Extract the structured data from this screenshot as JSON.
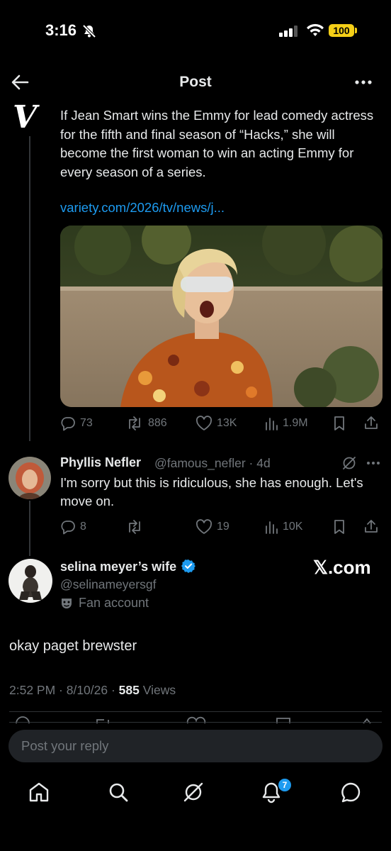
{
  "status_bar": {
    "time": "3:16",
    "battery": "100"
  },
  "header": {
    "title": "Post"
  },
  "quoted_post": {
    "logo": "V",
    "text": "If Jean Smart wins the Emmy for lead comedy actress for the fifth and final season of “Hacks,” she will become the first woman to win an acting Emmy for every season of a series.",
    "link": "variety.com/2026/tv/news/j...",
    "replies": "73",
    "reposts": "886",
    "likes": "13K",
    "views": "1.9M"
  },
  "reply": {
    "name": "Phyllis Nefler",
    "meta": "@famous_nefler · 4d",
    "text": "I'm sorry but this is ridiculous, she has enough. Let's move on.",
    "replies": "8",
    "reposts": "",
    "likes": "19",
    "views": "10K"
  },
  "main_post": {
    "name": "selina meyer’s wife",
    "handle": "@selinameyersgf",
    "fan_label": "Fan account",
    "xcom_badge": "𝕏.com",
    "text": "okay paget brewster",
    "timestamp": "2:52 PM · 8/10/26 · ",
    "views_count": "585",
    "views_label": " Views"
  },
  "reply_box": {
    "placeholder": "Post your reply"
  },
  "bottom_nav": {
    "notifications_badge": "7"
  },
  "colors": {
    "accent": "#1d9bf0",
    "muted": "#71767b",
    "background": "#000000",
    "battery": "#f5cf17"
  },
  "icons": [
    "back-arrow-icon",
    "more-icon",
    "reply-icon",
    "repost-icon",
    "like-icon",
    "views-icon",
    "bookmark-icon",
    "share-icon",
    "grok-icon",
    "verified-icon",
    "fan-mask-icon",
    "home-icon",
    "search-icon",
    "bell-icon",
    "messages-icon"
  ]
}
